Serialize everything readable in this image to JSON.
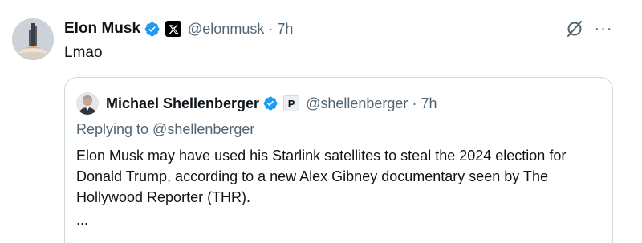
{
  "post": {
    "author_name": "Elon Musk",
    "handle": "@elonmusk",
    "separator": "·",
    "time": "7h",
    "text": "Lmao",
    "affiliation_icon": "x-logo-icon",
    "more_label": "···"
  },
  "quoted_post": {
    "author_name": "Michael Shellenberger",
    "affiliation_badge": "P",
    "handle": "@shellenberger",
    "separator": "·",
    "time": "7h",
    "replying_to": "Replying to @shellenberger",
    "body": "Elon Musk may have used his Starlink satellites to steal the 2024 election for Donald Trump, according to a new Alex Gibney documentary seen by The Hollywood Reporter (THR).",
    "truncation": "..."
  },
  "colors": {
    "text_primary": "#0f1419",
    "text_secondary": "#536471",
    "verified_blue": "#1d9bf0",
    "border": "#cfd9de"
  }
}
